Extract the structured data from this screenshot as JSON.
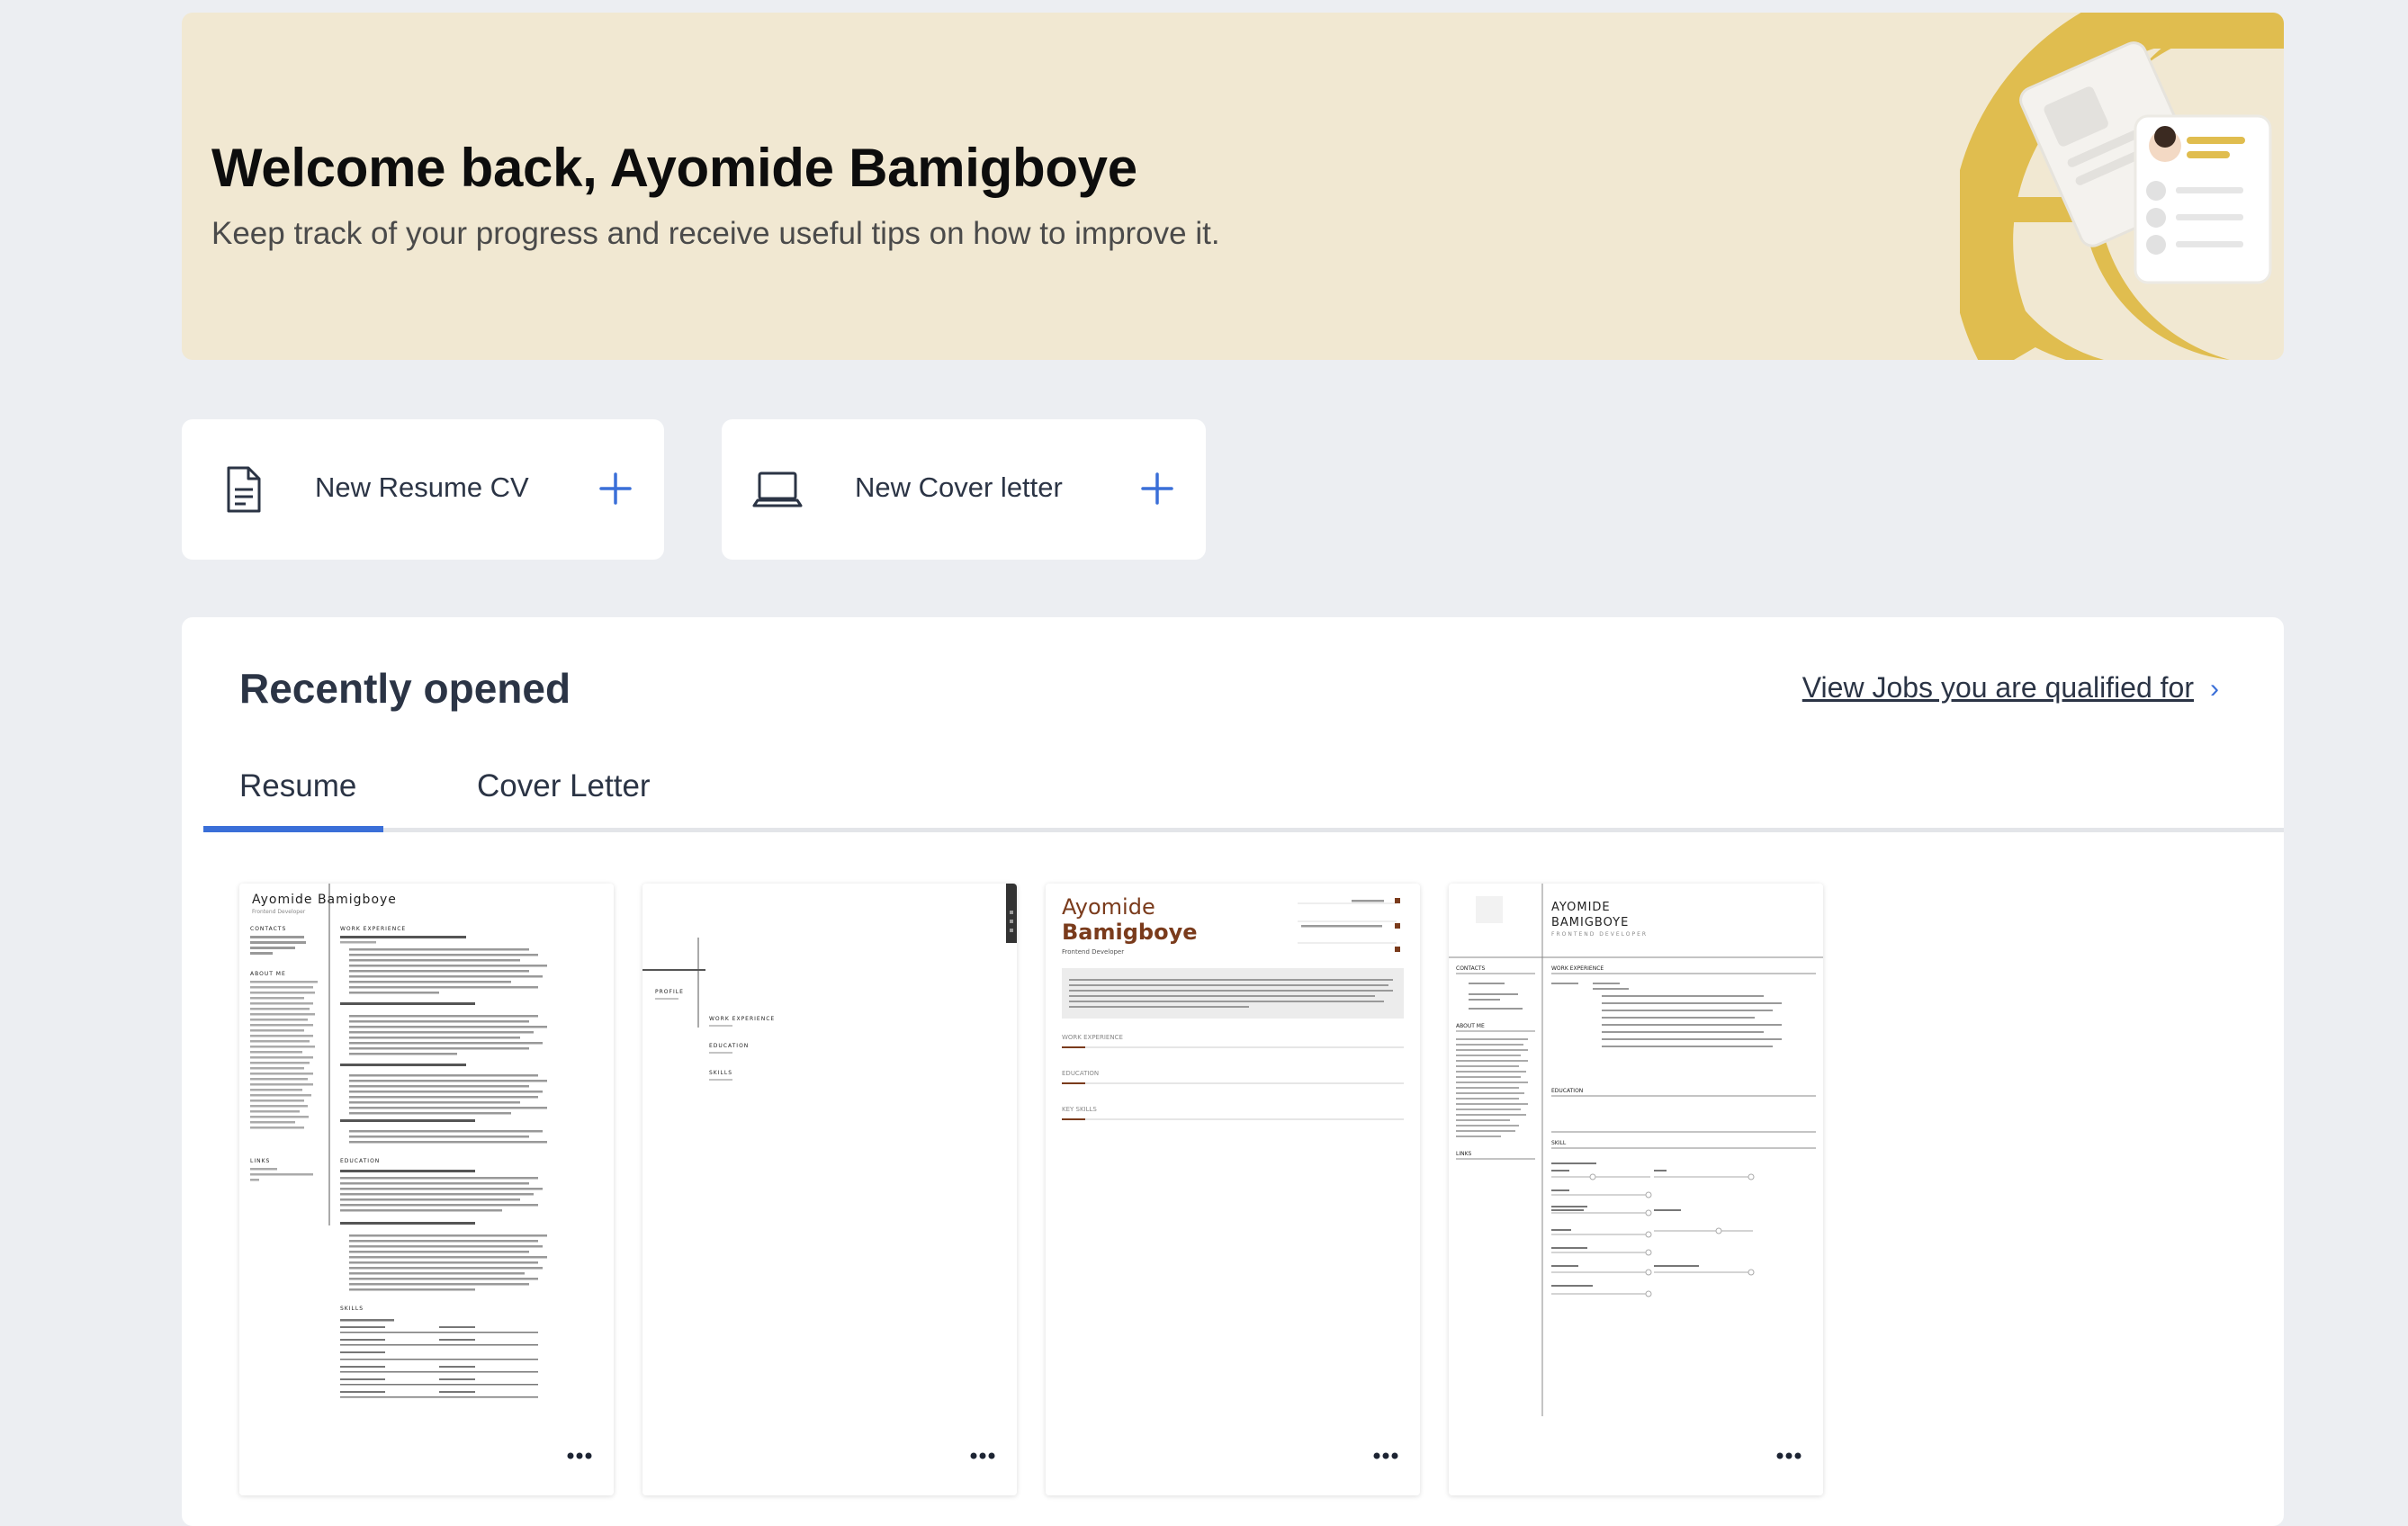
{
  "hero": {
    "title": "Welcome back, Ayomide Bamigboye",
    "subtitle": "Keep track of your progress and receive useful tips on how to improve it."
  },
  "actions": {
    "new_resume_label": "New Resume CV",
    "new_cover_label": "New Cover letter"
  },
  "recent": {
    "title": "Recently opened",
    "jobs_link": "View Jobs you are qualified for",
    "tabs": [
      {
        "label": "Resume",
        "active": true
      },
      {
        "label": "Cover Letter",
        "active": false
      }
    ]
  },
  "thumbnails": {
    "t1": {
      "name": "Ayomide Bamigboye",
      "role": "Frontend Developer",
      "contacts": "CONTACTS",
      "about": "ABOUT ME",
      "links": "LINKS",
      "work": "WORK EXPERIENCE",
      "education": "EDUCATION",
      "skills": "SKILLS"
    },
    "t2": {
      "profile": "PROFILE",
      "work": "WORK EXPERIENCE",
      "education": "EDUCATION",
      "skills": "SKILLS"
    },
    "t3": {
      "first": "Ayomide",
      "last": "Bamigboye",
      "role": "Frontend Developer",
      "work": "WORK EXPERIENCE",
      "education": "EDUCATION",
      "skills": "KEY SKILLS"
    },
    "t4": {
      "first": "AYOMIDE",
      "last": "BAMIGBOYE",
      "role": "FRONTEND DEVELOPER",
      "contacts": "CONTACTS",
      "about": "ABOUT ME",
      "links": "LINKS",
      "work": "WORK EXPERIENCE",
      "education": "EDUCATION",
      "skill": "SKILL"
    }
  },
  "colors": {
    "accent": "#3a6fd8",
    "hero_bg": "#f1e8d2",
    "hero_art": "#e0bd4f",
    "resume_brown": "#7a3b1c"
  },
  "icons": [
    "document-icon",
    "laptop-icon",
    "plus-icon",
    "chevron-right-icon",
    "more-horizontal-icon"
  ]
}
